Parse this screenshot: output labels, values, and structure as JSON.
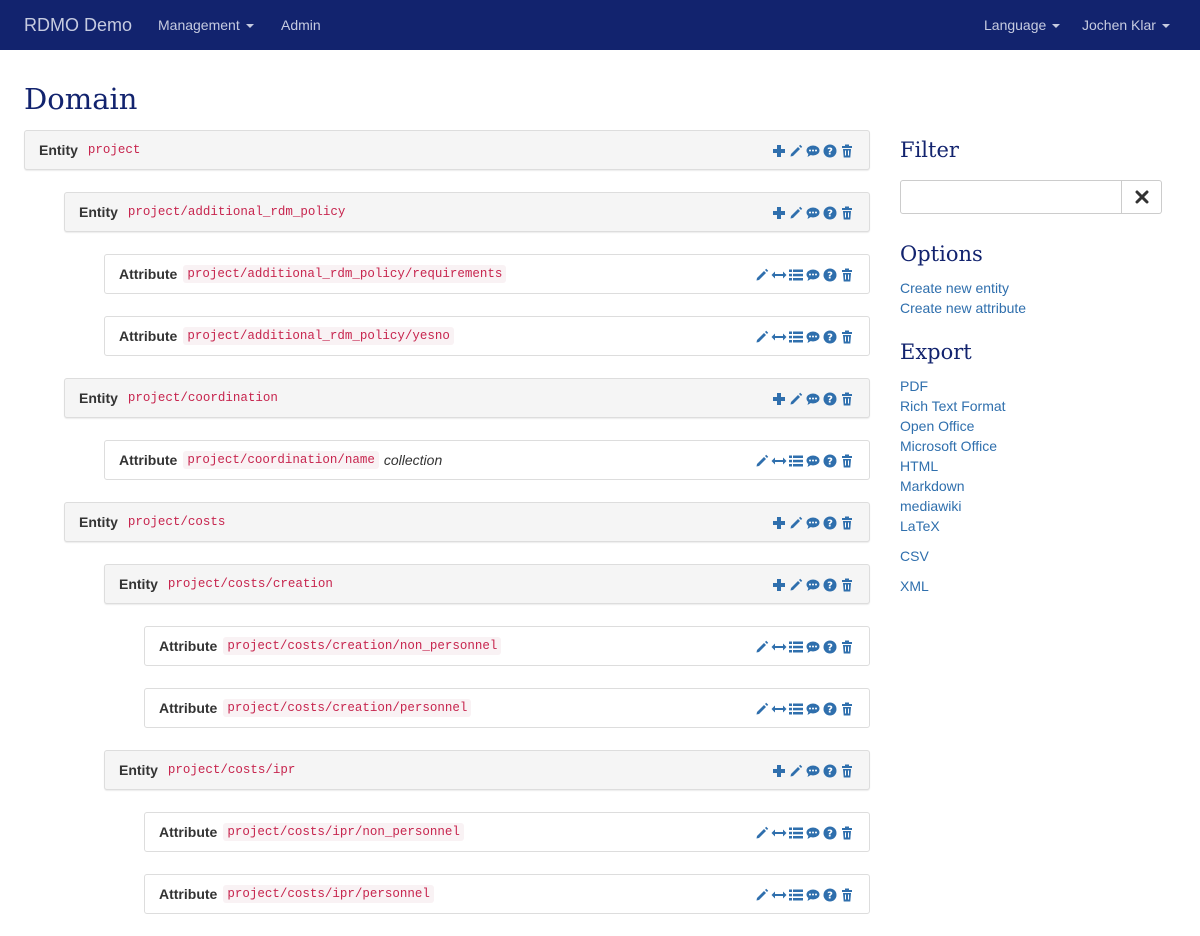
{
  "navbar": {
    "brand": "RDMO Demo",
    "management": "Management",
    "admin": "Admin",
    "language": "Language",
    "user": "Jochen Klar"
  },
  "page_title": "Domain",
  "tree": [
    {
      "kind": "entity",
      "type": "Entity",
      "path": "project",
      "level": 0,
      "extra": ""
    },
    {
      "kind": "entity",
      "type": "Entity",
      "path": "project/additional_rdm_policy",
      "level": 1,
      "extra": ""
    },
    {
      "kind": "attribute",
      "type": "Attribute",
      "path": "project/additional_rdm_policy/requirements",
      "level": 2,
      "extra": ""
    },
    {
      "kind": "attribute",
      "type": "Attribute",
      "path": "project/additional_rdm_policy/yesno",
      "level": 2,
      "extra": ""
    },
    {
      "kind": "entity",
      "type": "Entity",
      "path": "project/coordination",
      "level": 1,
      "extra": ""
    },
    {
      "kind": "attribute",
      "type": "Attribute",
      "path": "project/coordination/name",
      "level": 2,
      "extra": "collection"
    },
    {
      "kind": "entity",
      "type": "Entity",
      "path": "project/costs",
      "level": 1,
      "extra": ""
    },
    {
      "kind": "entity",
      "type": "Entity",
      "path": "project/costs/creation",
      "level": 2,
      "extra": ""
    },
    {
      "kind": "attribute",
      "type": "Attribute",
      "path": "project/costs/creation/non_personnel",
      "level": 3,
      "extra": ""
    },
    {
      "kind": "attribute",
      "type": "Attribute",
      "path": "project/costs/creation/personnel",
      "level": 3,
      "extra": ""
    },
    {
      "kind": "entity",
      "type": "Entity",
      "path": "project/costs/ipr",
      "level": 2,
      "extra": ""
    },
    {
      "kind": "attribute",
      "type": "Attribute",
      "path": "project/costs/ipr/non_personnel",
      "level": 3,
      "extra": ""
    },
    {
      "kind": "attribute",
      "type": "Attribute",
      "path": "project/costs/ipr/personnel",
      "level": 3,
      "extra": ""
    }
  ],
  "entity_icons": [
    "plus-icon",
    "pencil-icon",
    "comment-icon",
    "question-icon",
    "trash-icon"
  ],
  "attribute_icons": [
    "pencil-icon",
    "arrows-icon",
    "list-icon",
    "comment-icon",
    "question-icon",
    "trash-icon"
  ],
  "icon_color": "#2f6fad",
  "sidebar": {
    "filter_title": "Filter",
    "filter_value": "",
    "options_title": "Options",
    "options": [
      "Create new entity",
      "Create new attribute"
    ],
    "export_title": "Export",
    "export_group1": [
      "PDF",
      "Rich Text Format",
      "Open Office",
      "Microsoft Office",
      "HTML",
      "Markdown",
      "mediawiki",
      "LaTeX"
    ],
    "export_group2": [
      "CSV"
    ],
    "export_group3": [
      "XML"
    ]
  }
}
